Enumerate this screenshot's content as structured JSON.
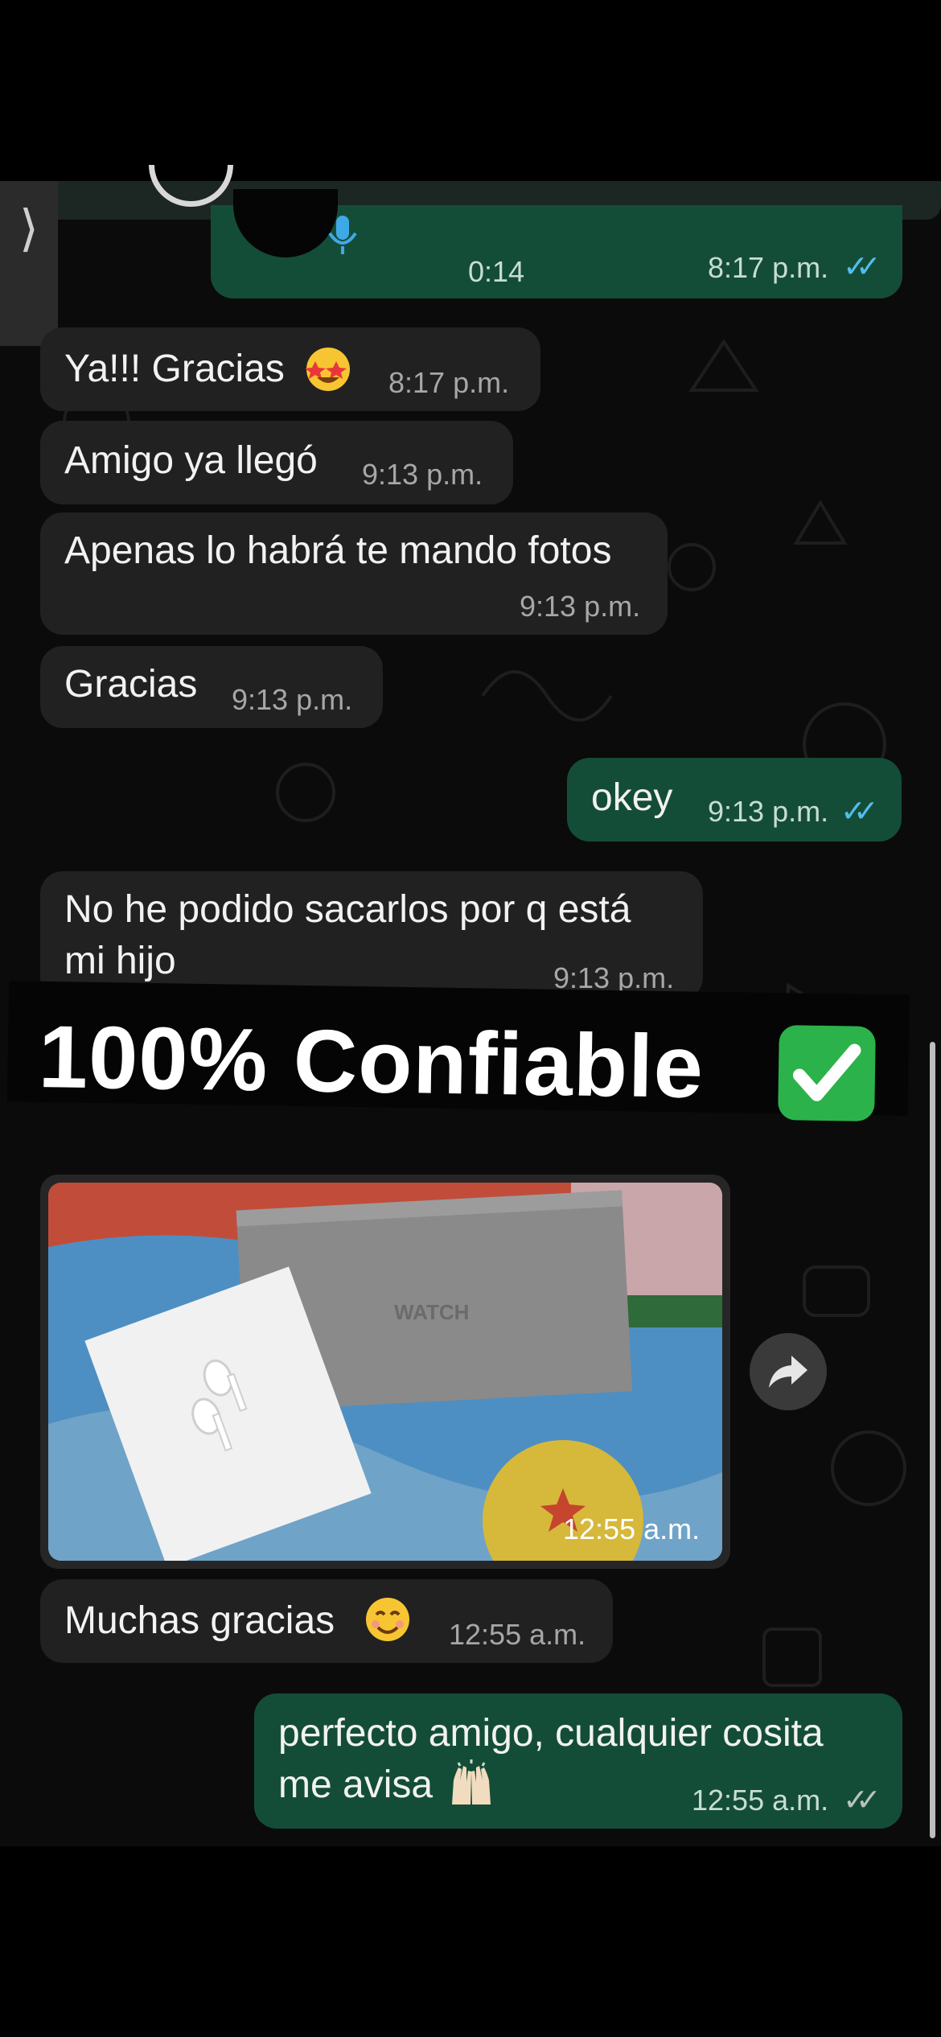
{
  "header": {
    "back_glyph": "⟩"
  },
  "messages": [
    {
      "id": "voice",
      "side": "out",
      "duration": "0:14",
      "time": "8:17 p.m.",
      "status": "read"
    },
    {
      "id": "m1",
      "side": "in",
      "text": "Ya!!! Gracias",
      "emoji": "star-struck-emoji",
      "time": "8:17 p.m."
    },
    {
      "id": "m2",
      "side": "in",
      "text": "Amigo ya llegó",
      "time": "9:13 p.m."
    },
    {
      "id": "m3",
      "side": "in",
      "text": "Apenas lo habrá te mando fotos",
      "time": "9:13 p.m."
    },
    {
      "id": "m4",
      "side": "in",
      "text": "Gracias",
      "time": "9:13 p.m."
    },
    {
      "id": "m5",
      "side": "out",
      "text": "okey",
      "time": "9:13 p.m.",
      "status": "read"
    },
    {
      "id": "m6",
      "side": "in",
      "text_line1": "No he podido sacarlos por q está",
      "text_line2": "mi hijo",
      "time": "9:13 p.m."
    },
    {
      "id": "photo",
      "side": "in",
      "image_text": "WATCH",
      "time": "12:55 a.m."
    },
    {
      "id": "m7",
      "side": "in",
      "text": "Muchas gracias",
      "emoji": "smiling-face-emoji",
      "time": "12:55 a.m."
    },
    {
      "id": "m8",
      "side": "out",
      "text_line1": "perfecto amigo, cualquier cosita",
      "text_line2": "me avisa",
      "emoji": "raising-hands-emoji",
      "time": "12:55 a.m.",
      "status": "delivered"
    }
  ],
  "overlay": {
    "banner_text": "100% Confiable",
    "banner_icon": "check-mark-button-emoji"
  },
  "colors": {
    "incoming_bubble": "#212121",
    "outgoing_bubble": "#144d37",
    "read_ticks": "#53bdeb",
    "banner_check": "#2cb24a"
  }
}
